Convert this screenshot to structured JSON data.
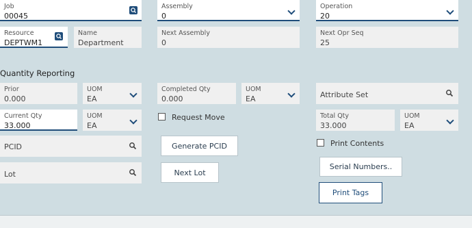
{
  "job": {
    "label": "Job",
    "value": "00045"
  },
  "assembly": {
    "label": "Assembly",
    "value": "0"
  },
  "operation": {
    "label": "Operation",
    "value": "20"
  },
  "resource": {
    "label": "Resource",
    "value": "DEPTWM1"
  },
  "name": {
    "label": "Name",
    "value": "Department"
  },
  "next_assembly": {
    "label": "Next Assembly",
    "value": "0"
  },
  "next_opr_seq": {
    "label": "Next Opr Seq",
    "value": "25"
  },
  "section_title": "Quantity Reporting",
  "prior": {
    "label": "Prior",
    "value": "0.000"
  },
  "prior_uom": {
    "label": "UOM",
    "value": "EA"
  },
  "completed_qty": {
    "label": "Completed Qty",
    "value": "0.000"
  },
  "completed_uom": {
    "label": "UOM",
    "value": "EA"
  },
  "attribute_set": {
    "label": "Attribute Set"
  },
  "current_qty": {
    "label": "Current Qty",
    "value": "33.000"
  },
  "current_uom": {
    "label": "UOM",
    "value": "EA"
  },
  "request_move": {
    "label": "Request Move",
    "checked": false
  },
  "total_qty": {
    "label": "Total Qty",
    "value": "33.000"
  },
  "total_uom": {
    "label": "UOM",
    "value": "EA"
  },
  "pcid": {
    "label": "PCID"
  },
  "generate_pcid": {
    "label": "Generate PCID"
  },
  "print_contents": {
    "label": "Print Contents",
    "checked": false
  },
  "lot": {
    "label": "Lot"
  },
  "next_lot": {
    "label": "Next Lot"
  },
  "serial_numbers": {
    "label": "Serial Numbers.."
  },
  "print_tags": {
    "label": "Print Tags"
  },
  "colors": {
    "accent": "#1f4d7a",
    "background": "#cfdde2"
  }
}
